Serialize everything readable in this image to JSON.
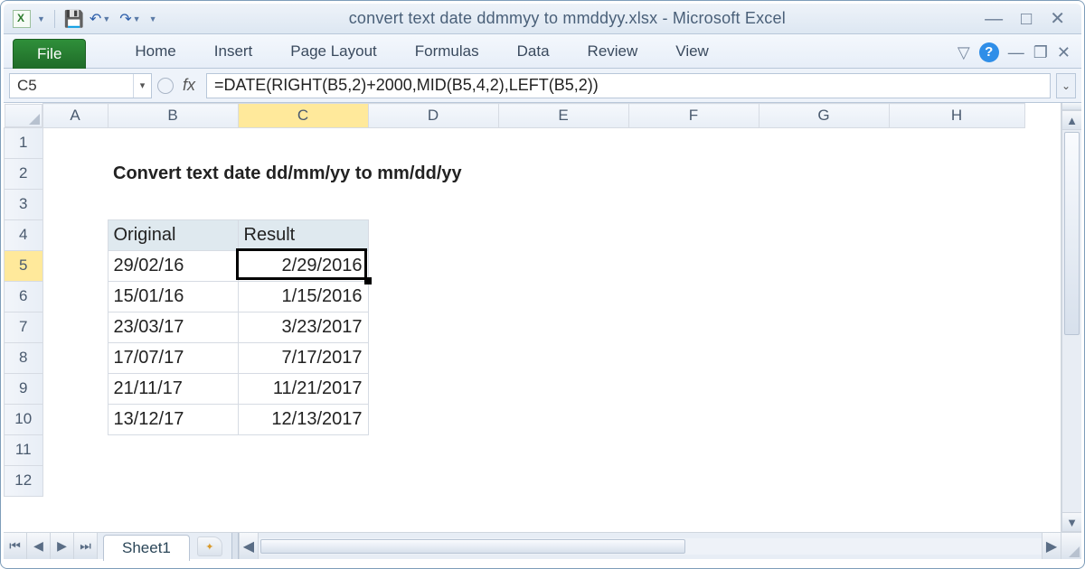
{
  "window": {
    "title": "convert text date ddmmyy to mmddyy.xlsx  -  Microsoft Excel"
  },
  "ribbon": {
    "file": "File",
    "tabs": [
      "Home",
      "Insert",
      "Page Layout",
      "Formulas",
      "Data",
      "Review",
      "View"
    ]
  },
  "namebox": "C5",
  "fx_label": "fx",
  "formula": "=DATE(RIGHT(B5,2)+2000,MID(B5,4,2),LEFT(B5,2))",
  "columns": [
    "A",
    "B",
    "C",
    "D",
    "E",
    "F",
    "G",
    "H"
  ],
  "rows": [
    "1",
    "2",
    "3",
    "4",
    "5",
    "6",
    "7",
    "8",
    "9",
    "10",
    "11",
    "12"
  ],
  "sheet": {
    "title_cell": "Convert text date dd/mm/yy to mm/dd/yy",
    "headers": {
      "original": "Original",
      "result": "Result"
    },
    "data": [
      {
        "original": "29/02/16",
        "result": "2/29/2016"
      },
      {
        "original": "15/01/16",
        "result": "1/15/2016"
      },
      {
        "original": "23/03/17",
        "result": "3/23/2017"
      },
      {
        "original": "17/07/17",
        "result": "7/17/2017"
      },
      {
        "original": "21/11/17",
        "result": "11/21/2017"
      },
      {
        "original": "13/12/17",
        "result": "12/13/2017"
      }
    ]
  },
  "tabs": {
    "sheet1": "Sheet1"
  },
  "selected": {
    "col": "C",
    "row": "5"
  }
}
